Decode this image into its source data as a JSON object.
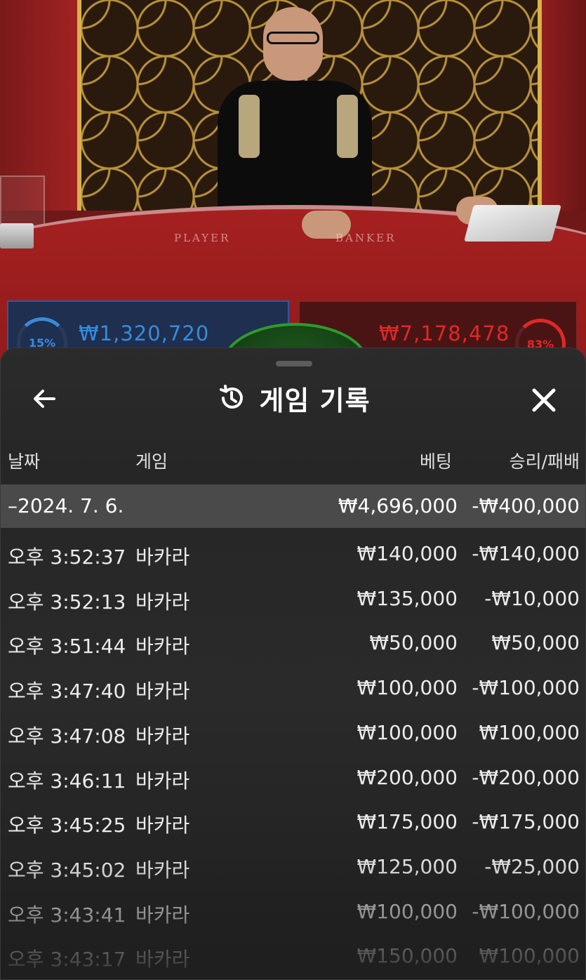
{
  "scene": {
    "table_label_player": "PLAYER",
    "table_label_banker": "BANKER",
    "player": {
      "percent": "15%",
      "amount": "₩1,320,720",
      "color": "#3a8bd8"
    },
    "banker": {
      "percent": "83%",
      "amount": "₩7,178,478",
      "color": "#e02828"
    }
  },
  "sheet": {
    "title": "게임 기록",
    "icons": {
      "back": "arrow-left-icon",
      "history": "history-icon",
      "close": "close-icon"
    },
    "columns": {
      "date": "날짜",
      "game": "게임",
      "bet": "베팅",
      "result": "승리/패배"
    },
    "date_group": {
      "label": "–2024. 7. 6.",
      "bet_total": "₩4,696,000",
      "result_total": "-₩400,000"
    },
    "rows": [
      {
        "time": "오후 3:52:37",
        "game": "바카라",
        "bet": "₩140,000",
        "result": "-₩140,000"
      },
      {
        "time": "오후 3:52:13",
        "game": "바카라",
        "bet": "₩135,000",
        "result": "-₩10,000"
      },
      {
        "time": "오후 3:51:44",
        "game": "바카라",
        "bet": "₩50,000",
        "result": "₩50,000"
      },
      {
        "time": "오후 3:47:40",
        "game": "바카라",
        "bet": "₩100,000",
        "result": "-₩100,000"
      },
      {
        "time": "오후 3:47:08",
        "game": "바카라",
        "bet": "₩100,000",
        "result": "₩100,000"
      },
      {
        "time": "오후 3:46:11",
        "game": "바카라",
        "bet": "₩200,000",
        "result": "-₩200,000"
      },
      {
        "time": "오후 3:45:25",
        "game": "바카라",
        "bet": "₩175,000",
        "result": "-₩175,000"
      },
      {
        "time": "오후 3:45:02",
        "game": "바카라",
        "bet": "₩125,000",
        "result": "-₩25,000"
      },
      {
        "time": "오후 3:43:41",
        "game": "바카라",
        "bet": "₩100,000",
        "result": "-₩100,000"
      },
      {
        "time": "오후 3:43:17",
        "game": "바카라",
        "bet": "₩150,000",
        "result": "₩100,000"
      }
    ]
  }
}
